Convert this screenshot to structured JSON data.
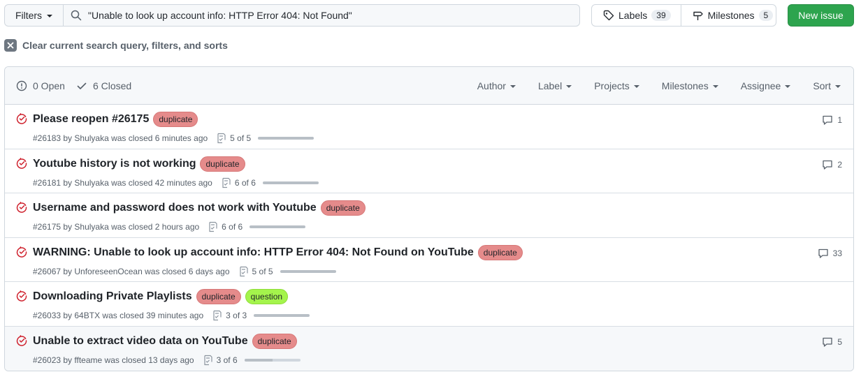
{
  "toolbar": {
    "filters_label": "Filters",
    "search_value": "\"Unable to look up account info: HTTP Error 404: Not Found\"",
    "labels_label": "Labels",
    "labels_count": "39",
    "milestones_label": "Milestones",
    "milestones_count": "5",
    "new_issue_label": "New issue"
  },
  "clear_filters_label": "Clear current search query, filters, and sorts",
  "header": {
    "open_label": "0 Open",
    "closed_label": "6 Closed",
    "filters": [
      "Author",
      "Label",
      "Projects",
      "Milestones",
      "Assignee",
      "Sort"
    ]
  },
  "colors": {
    "closed_icon": "#cf222e",
    "duplicate_label": "#e58b8b",
    "question_label": "#a4f44c",
    "new_issue_button": "#2da44e"
  },
  "issues": [
    {
      "title": "Please reopen #26175",
      "labels": [
        "duplicate"
      ],
      "meta": "#26183 by Shulyaka was closed 6 minutes ago",
      "tasks": "5 of 5",
      "progress": 1.0,
      "comments": "1"
    },
    {
      "title": "Youtube history is not working",
      "labels": [
        "duplicate"
      ],
      "meta": "#26181 by Shulyaka was closed 42 minutes ago",
      "tasks": "6 of 6",
      "progress": 1.0,
      "comments": "2"
    },
    {
      "title": "Username and password does not work with Youtube",
      "labels": [
        "duplicate"
      ],
      "meta": "#26175 by Shulyaka was closed 2 hours ago",
      "tasks": "6 of 6",
      "progress": 1.0,
      "comments": ""
    },
    {
      "title": "WARNING: Unable to look up account info: HTTP Error 404: Not Found on YouTube",
      "labels": [
        "duplicate"
      ],
      "meta": "#26067 by UnforeseenOcean was closed 6 days ago",
      "tasks": "5 of 5",
      "progress": 1.0,
      "comments": "33"
    },
    {
      "title": "Downloading Private Playlists",
      "labels": [
        "duplicate",
        "question"
      ],
      "meta": "#26033 by 64BTX was closed 39 minutes ago",
      "tasks": "3 of 3",
      "progress": 1.0,
      "comments": ""
    },
    {
      "title": "Unable to extract video data on YouTube",
      "labels": [
        "duplicate"
      ],
      "meta": "#26023 by ffteame was closed 13 days ago",
      "tasks": "3 of 6",
      "progress": 0.5,
      "comments": "5"
    }
  ]
}
